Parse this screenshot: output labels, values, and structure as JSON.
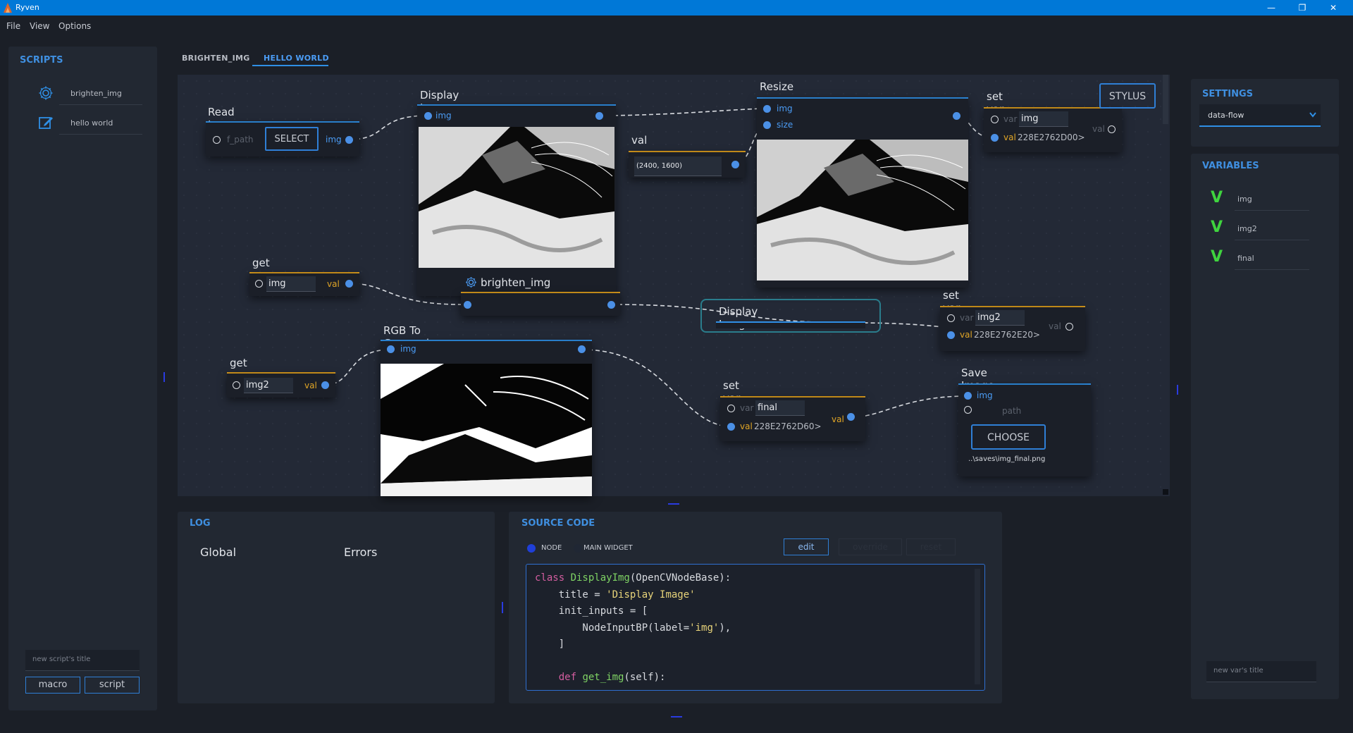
{
  "window": {
    "title": "Ryven",
    "minimize": "—",
    "restore": "❐",
    "close": "✕"
  },
  "menu": [
    "File",
    "View",
    "Options"
  ],
  "scripts_panel": {
    "title": "SCRIPTS",
    "items": [
      {
        "icon": "gear-icon",
        "label": "brighten_img"
      },
      {
        "icon": "edit-icon",
        "label": "hello world"
      }
    ],
    "new_title_placeholder": "new script's title",
    "macro_label": "macro",
    "script_label": "script"
  },
  "tabs": {
    "items": [
      "BRIGHTEN_IMG",
      "HELLO WORLD"
    ],
    "active": 1
  },
  "nodes": {
    "read_image": {
      "title": "Read Image",
      "input_label": "f_path",
      "button": "SELECT",
      "output_label": "img"
    },
    "display_image_1": {
      "title": "Display Image",
      "input_label": "img"
    },
    "val": {
      "title": "val",
      "value": "(2400, 1600)"
    },
    "resize": {
      "title": "Resize",
      "input1": "img",
      "input2": "size"
    },
    "set_var_1": {
      "title": "set var",
      "var_label": "var",
      "var_value": "img",
      "val_label": "val",
      "val_value": "228E2762D00>",
      "out_label": "val"
    },
    "stylus": {
      "label": "STYLUS"
    },
    "get_var_1": {
      "title": "get var",
      "value": "img",
      "out_label": "val"
    },
    "brighten_img": {
      "title": "brighten_img"
    },
    "display_image_2": {
      "title": "Display Image"
    },
    "set_var_2": {
      "title": "set var",
      "var_label": "var",
      "var_value": "img2",
      "val_label": "val",
      "val_value": "228E2762E20>",
      "out_label": "val"
    },
    "rgb_to_grey": {
      "title": "RGB To Greyscale",
      "input_label": "img"
    },
    "get_var_2": {
      "title": "get var",
      "value": "img2",
      "out_label": "val"
    },
    "set_var_3": {
      "title": "set var",
      "var_label": "var",
      "var_value": "final",
      "val_label": "val",
      "val_value": "228E2762D60>",
      "out_label": "val"
    },
    "save_image": {
      "title": "Save Image",
      "input1": "img",
      "input2": "path",
      "button": "CHOOSE",
      "path_value": "..\\saves\\img_final.png"
    }
  },
  "log_panel": {
    "title": "LOG",
    "tab1": "Global",
    "tab2": "Errors"
  },
  "source_panel": {
    "title": "SOURCE CODE",
    "radio1": "NODE",
    "radio2": "MAIN WIDGET",
    "edit_label": "edit",
    "override_label": "override",
    "reset_label": "reset",
    "code_lines": [
      [
        [
          "kw",
          "class "
        ],
        [
          "fn",
          "DisplayImg"
        ],
        [
          "pl",
          "(OpenCVNodeBase):"
        ]
      ],
      [
        [
          "pl",
          "    title = "
        ],
        [
          "st",
          "'Display Image'"
        ]
      ],
      [
        [
          "pl",
          "    init_inputs = ["
        ]
      ],
      [
        [
          "pl",
          "        NodeInputBP(label="
        ],
        [
          "st",
          "'img'"
        ],
        [
          "pl",
          "),"
        ]
      ],
      [
        [
          "pl",
          "    ]"
        ]
      ],
      [
        [
          "pl",
          ""
        ]
      ],
      [
        [
          "kw",
          "    def "
        ],
        [
          "fn",
          "get_img"
        ],
        [
          "pl",
          "(self):"
        ]
      ]
    ]
  },
  "settings_panel": {
    "title": "SETTINGS",
    "mode": "data-flow"
  },
  "variables_panel": {
    "title": "VARIABLES",
    "items": [
      {
        "mark": "V",
        "name": "img"
      },
      {
        "mark": "V",
        "name": "img2"
      },
      {
        "mark": "V",
        "name": "final"
      }
    ],
    "new_title_placeholder": "new var's title"
  },
  "colors": {
    "accent": "#2f8fe5",
    "orange": "#d89a1c",
    "bg": "#1b1f27",
    "panel": "#222832"
  }
}
